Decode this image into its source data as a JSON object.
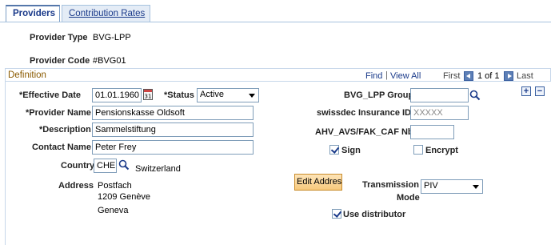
{
  "tabs": [
    {
      "label": "Providers",
      "active": true
    },
    {
      "label": "Contribution Rates",
      "active": false
    }
  ],
  "header": {
    "provider_type_label": "Provider Type",
    "provider_type_value": "BVG-LPP",
    "provider_code_label": "Provider Code",
    "provider_code_value": "#BVG01"
  },
  "section": {
    "title": "Definition",
    "find_label": "Find",
    "separator": "|",
    "view_all_label": "View All",
    "first_label": "First",
    "counter": "1 of 1",
    "last_label": "Last"
  },
  "form": {
    "effective_date_label": "*Effective Date",
    "effective_date_value": "01.01.1960",
    "status_label": "*Status",
    "status_value": "Active",
    "provider_name_label": "*Provider Name",
    "provider_name_value": "Pensionskasse Oldsoft",
    "description_label": "*Description",
    "description_value": "Sammelstiftung",
    "contact_name_label": "Contact Name",
    "contact_name_value": "Peter Frey",
    "country_label": "Country",
    "country_value": "CHE",
    "country_name": "Switzerland",
    "address_label": "Address",
    "address_lines": [
      "Postfach",
      "1209 Genève",
      "Geneva"
    ],
    "edit_address_label": "Edit Addres",
    "bvg_group_label": "BVG_LPP Group",
    "bvg_group_value": "",
    "swissdec_label": "swissdec Insurance ID",
    "swissdec_placeholder": "XXXXX",
    "ahv_label": "AHV_AVS/FAK_CAF Nbr",
    "ahv_value": "",
    "sign_label": "Sign",
    "sign_checked": true,
    "encrypt_label": "Encrypt",
    "encrypt_checked": false,
    "transmission_label_line1": "Transmission",
    "transmission_label_line2": "Mode",
    "transmission_value": "PIV",
    "use_distributor_label": "Use distributor",
    "use_distributor_checked": true
  },
  "icons": {
    "calendar": "calendar-icon",
    "lookup": "magnifier-icon",
    "add_row": "plus-icon",
    "delete_row": "minus-icon"
  },
  "colors": {
    "link": "#1a3a8a",
    "section_title": "#8a5a00",
    "tab_border": "#a6c2de",
    "button_fill": "#f7c97c"
  }
}
